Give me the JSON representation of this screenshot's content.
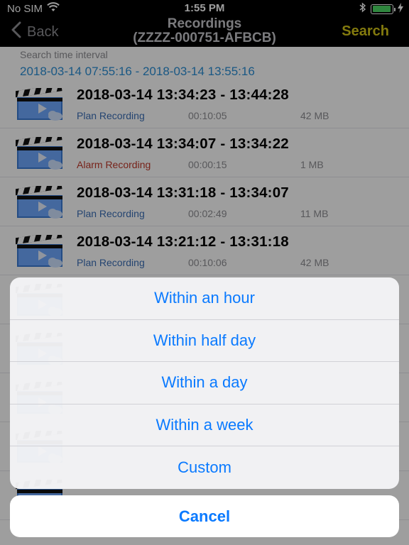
{
  "colors": {
    "accent": "#0a7aff",
    "interval": "#2b8fd6",
    "search": "#d4c617",
    "plan": "#3b6fb6",
    "alarm": "#c0392b",
    "battery": "#4cd964"
  },
  "status_bar": {
    "carrier": "No SIM",
    "time": "1:55 PM",
    "icons": [
      "wifi-icon",
      "bluetooth-icon",
      "battery-icon",
      "charging-icon"
    ],
    "battery_level": 0.95
  },
  "nav": {
    "back_label": "Back",
    "title_line1": "Recordings",
    "title_line2": "(ZZZZ-000751-AFBCB)",
    "search_label": "Search"
  },
  "search_interval": {
    "label": "Search time interval",
    "value": "2018-03-14 07:55:16 - 2018-03-14 13:55:16"
  },
  "recordings": [
    {
      "title": "2018-03-14  13:34:23 - 13:44:28",
      "type": "Plan Recording",
      "kind": "plan",
      "duration": "00:10:05",
      "size": "42 MB"
    },
    {
      "title": "2018-03-14  13:34:07 - 13:34:22",
      "type": "Alarm Recording",
      "kind": "alarm",
      "duration": "00:00:15",
      "size": "1 MB"
    },
    {
      "title": "2018-03-14  13:31:18 - 13:34:07",
      "type": "Plan Recording",
      "kind": "plan",
      "duration": "00:02:49",
      "size": "11 MB"
    },
    {
      "title": "2018-03-14  13:21:12 - 13:31:18",
      "type": "Plan Recording",
      "kind": "plan",
      "duration": "00:10:06",
      "size": "42 MB"
    },
    {
      "title": "",
      "type": "",
      "kind": "plan",
      "duration": "",
      "size": ""
    },
    {
      "title": "",
      "type": "",
      "kind": "plan",
      "duration": "",
      "size": ""
    },
    {
      "title": "",
      "type": "",
      "kind": "plan",
      "duration": "",
      "size": ""
    },
    {
      "title": "",
      "type": "",
      "kind": "plan",
      "duration": "",
      "size": ""
    },
    {
      "title": "",
      "type": "",
      "kind": "plan",
      "duration": "",
      "size": ""
    }
  ],
  "action_sheet": {
    "options": [
      "Within an hour",
      "Within half day",
      "Within a day",
      "Within a week",
      "Custom"
    ],
    "cancel_label": "Cancel"
  }
}
